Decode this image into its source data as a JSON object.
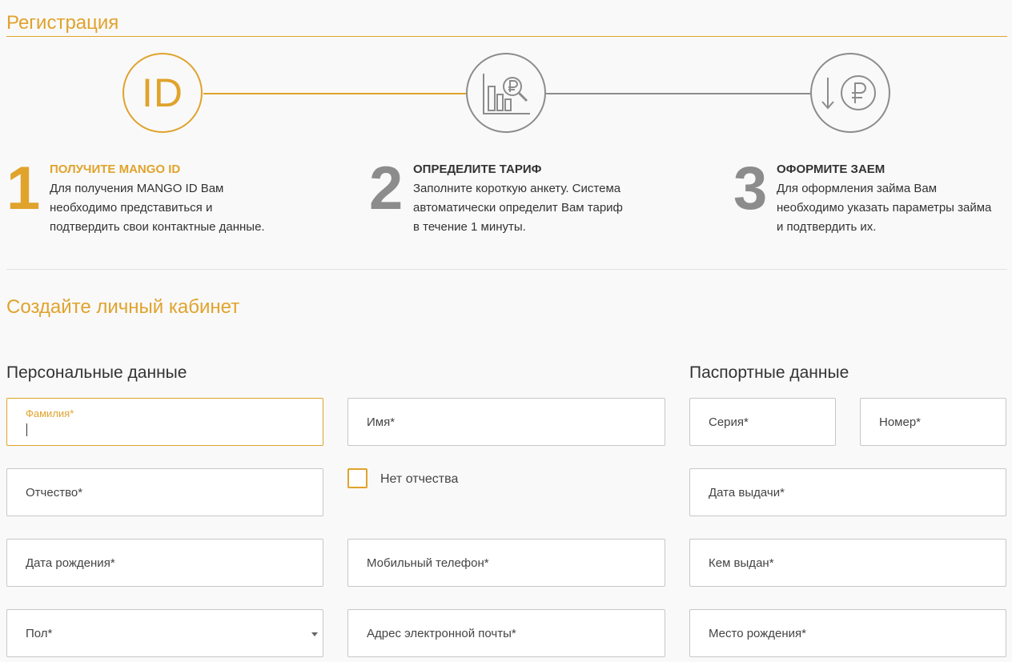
{
  "header": {
    "title": "Регистрация"
  },
  "colors": {
    "accent": "#e0a32c",
    "inactive": "#8c8c8c",
    "text": "#333333"
  },
  "steps": [
    {
      "number": "1",
      "title": "ПОЛУЧИТЕ MANGO ID",
      "desc": [
        "Для получения MANGO ID Вам",
        "необходимо представиться и",
        "подтвердить свои контактные данные."
      ],
      "icon": "id-icon",
      "icon_text": "ID"
    },
    {
      "number": "2",
      "title": "ОПРЕДЕЛИТЕ ТАРИФ",
      "desc": [
        "Заполните короткую анкету. Система",
        "автоматически определит Вам тариф",
        "в течение 1 минуты."
      ],
      "icon": "chart-ruble-search-icon"
    },
    {
      "number": "3",
      "title": "ОФОРМИТЕ ЗАЕМ",
      "desc": [
        "Для оформления займа Вам",
        "необходимо указать параметры займа",
        "и подтвердить их."
      ],
      "icon": "ruble-download-icon"
    }
  ],
  "section": {
    "title": "Создайте личный кабинет"
  },
  "personal": {
    "title": "Персональные данные",
    "surname": {
      "label": "Фамилия*",
      "value": ""
    },
    "name": {
      "label": "Имя*"
    },
    "patronymic": {
      "label": "Отчество*"
    },
    "no_patronymic": {
      "label": "Нет отчества",
      "checked": false
    },
    "birth_date": {
      "label": "Дата рождения*"
    },
    "phone": {
      "label": "Мобильный телефон*"
    },
    "gender": {
      "label": "Пол*"
    },
    "email": {
      "label": "Адрес электронной почты*"
    }
  },
  "passport": {
    "title": "Паспортные данные",
    "series": {
      "label": "Серия*"
    },
    "number": {
      "label": "Номер*"
    },
    "issue_date": {
      "label": "Дата выдачи*"
    },
    "issued_by": {
      "label": "Кем выдан*"
    },
    "birth_place": {
      "label": "Место рождения*"
    }
  }
}
